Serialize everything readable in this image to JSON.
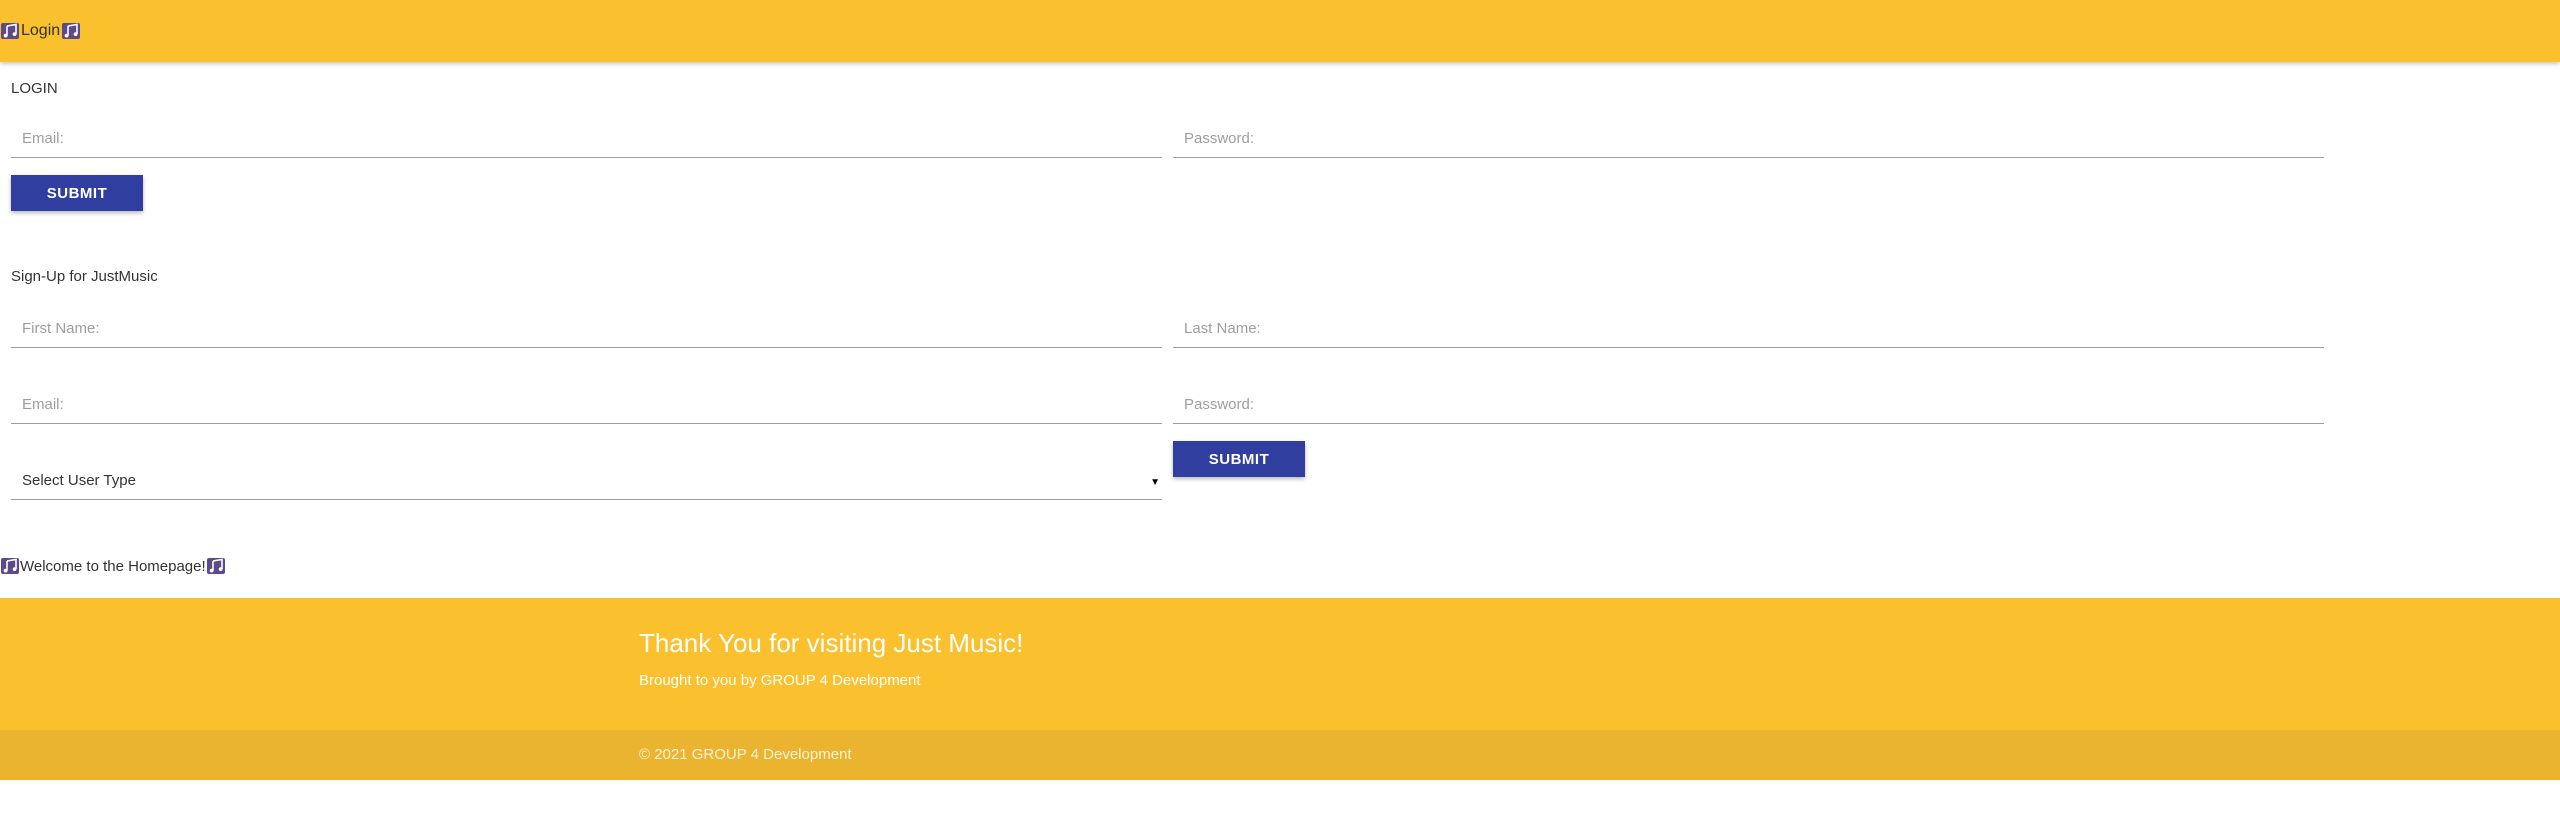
{
  "header": {
    "brand_label": "Login",
    "icon": "music-note-icon"
  },
  "colors": {
    "primary_bar": "#fbc02d",
    "footer_bottom": "#ebb430",
    "button": "#303f9f"
  },
  "login": {
    "title": "LOGIN",
    "email_placeholder": "Email:",
    "password_placeholder": "Password:",
    "submit_label": "SUBMIT"
  },
  "signup": {
    "title": "Sign-Up for JustMusic",
    "first_name_placeholder": "First Name:",
    "last_name_placeholder": "Last Name:",
    "email_placeholder": "Email:",
    "password_placeholder": "Password:",
    "user_type_label": "Select User Type",
    "submit_label": "SUBMIT"
  },
  "welcome": {
    "text": "Welcome to the Homepage!"
  },
  "footer": {
    "title": "Thank You for visiting Just Music!",
    "subtitle": "Brought to you by GROUP 4 Development",
    "copyright": "© 2021 GROUP 4 Development"
  }
}
